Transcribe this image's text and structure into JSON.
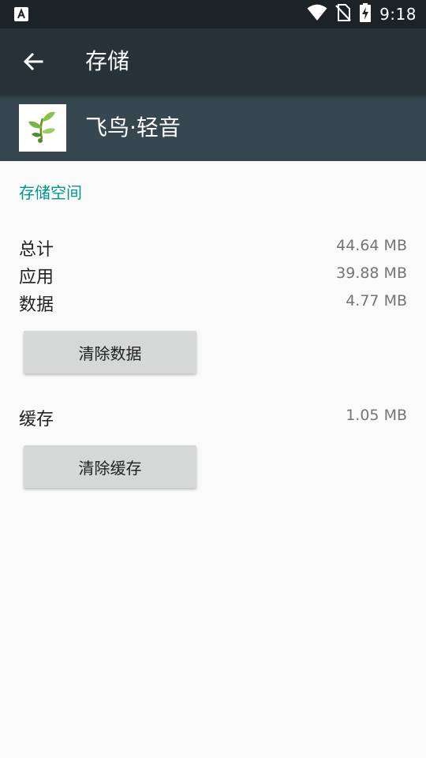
{
  "status_bar": {
    "time": "9:18",
    "icons": [
      "notification-a-icon",
      "wifi-icon",
      "no-sim-icon",
      "battery-charging-icon"
    ]
  },
  "app_bar": {
    "back_icon": "arrow-back-icon",
    "title": "存储"
  },
  "app_header": {
    "icon": "app-leaf-icon",
    "name": "飞鸟·轻音"
  },
  "storage": {
    "section_title": "存储空间",
    "rows": [
      {
        "label": "总计",
        "value": "44.64 MB"
      },
      {
        "label": "应用",
        "value": "39.88 MB"
      },
      {
        "label": "数据",
        "value": "4.77 MB"
      }
    ],
    "clear_data_label": "清除数据",
    "cache": {
      "label": "缓存",
      "value": "1.05 MB"
    },
    "clear_cache_label": "清除缓存"
  },
  "colors": {
    "status_bar": "#1b2327",
    "app_bar": "#263238",
    "app_header": "#37474f",
    "accent": "#009688",
    "background": "#fafafa",
    "button": "#d6d7d7"
  }
}
